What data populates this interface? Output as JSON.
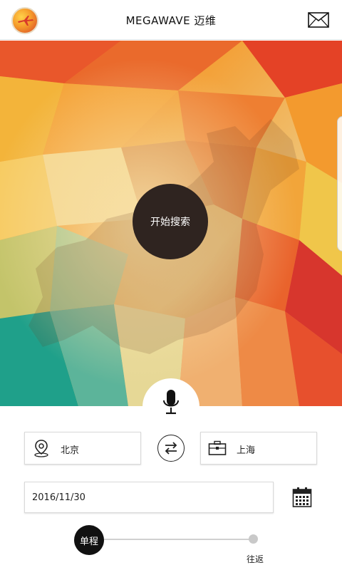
{
  "header": {
    "title": "MEGAWAVE 迈维",
    "logo_icon": "airplane-logo-icon",
    "mail_icon": "mail-icon"
  },
  "hero": {
    "search_button_label": "开始搜索",
    "voice_icon": "microphone-icon"
  },
  "route": {
    "from": "北京",
    "to": "上海",
    "from_icon": "location-pin-icon",
    "to_icon": "briefcase-icon",
    "swap_icon": "swap-arrows-icon"
  },
  "date": {
    "value": "2016/11/30",
    "calendar_icon": "calendar-icon"
  },
  "trip_type": {
    "one_way": "单程",
    "round_trip": "往返",
    "selected": "单程"
  },
  "colors": {
    "header_bg": "#ffffff",
    "search_button_bg": "#2f2420",
    "toggle_active": "#111111",
    "toggle_inactive": "#c9c9c9"
  }
}
